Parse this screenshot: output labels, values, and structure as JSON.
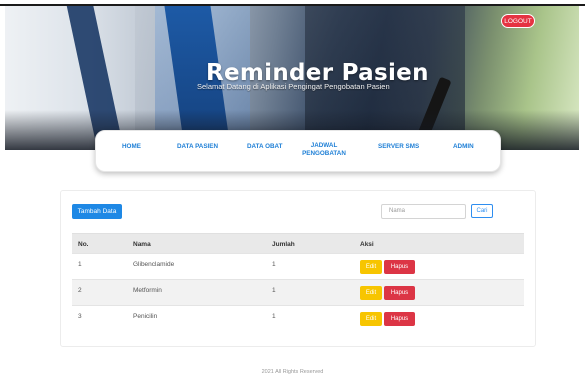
{
  "header": {
    "title": "Reminder Pasien",
    "subtitle": "Selamat Datang di Aplikasi Pengingat Pengobatan Pasien",
    "logout_label": "LOGOUT"
  },
  "nav": {
    "items": [
      {
        "label": "HOME"
      },
      {
        "label": "DATA PASIEN"
      },
      {
        "label": "DATA OBAT"
      },
      {
        "label": "JADWAL\nPENGOBATAN"
      },
      {
        "label": "SERVER SMS"
      },
      {
        "label": "ADMIN"
      }
    ]
  },
  "toolbar": {
    "add_label": "Tambah Data",
    "search_placeholder": "Nama",
    "search_label": "Cari"
  },
  "table": {
    "headers": [
      "No.",
      "Nama",
      "Jumlah",
      "Aksi"
    ],
    "rows": [
      {
        "no": "1",
        "nama": "Glibenclamide",
        "jumlah": "1"
      },
      {
        "no": "2",
        "nama": "Metformin",
        "jumlah": "1"
      },
      {
        "no": "3",
        "nama": "Penicilin",
        "jumlah": "1"
      }
    ],
    "edit_label": "Edit",
    "delete_label": "Hapus"
  },
  "footer": {
    "text": "2021 All Rights Reserved"
  },
  "colors": {
    "accent": "#1e88e5",
    "logout": "#e53342",
    "edit": "#f7c500",
    "delete": "#dc3545"
  }
}
